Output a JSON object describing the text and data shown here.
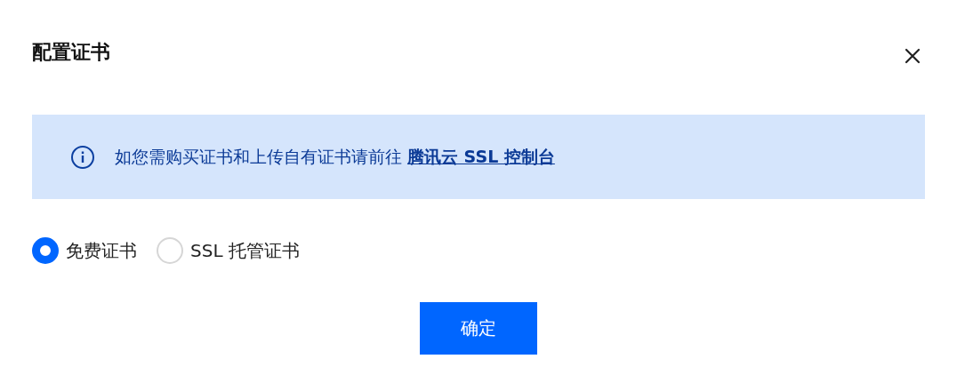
{
  "dialog": {
    "title": "配置证书"
  },
  "notice": {
    "text": "如您需购买证书和上传自有证书请前往",
    "link": "腾讯云 SSL 控制台"
  },
  "options": [
    {
      "label": "免费证书",
      "selected": true
    },
    {
      "label": "SSL 托管证书",
      "selected": false
    }
  ],
  "buttons": [
    "确定"
  ]
}
